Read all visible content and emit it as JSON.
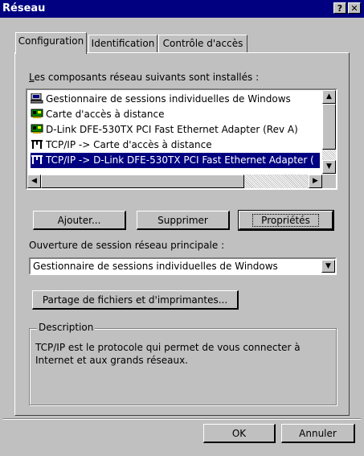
{
  "window": {
    "title": "Réseau",
    "help_button": "?",
    "close_button": "✕"
  },
  "tabs": [
    {
      "label": "Configuration",
      "active": true
    },
    {
      "label": "Identification",
      "active": false
    },
    {
      "label": "Contrôle d'accès",
      "active": false
    }
  ],
  "components": {
    "label": "Les composants réseau suivants sont installés :",
    "items": [
      {
        "label": "Gestionnaire de sessions individuelles de Windows",
        "icon": "client-icon",
        "selected": false
      },
      {
        "label": "Carte d'accès à distance",
        "icon": "network-card-icon",
        "selected": false
      },
      {
        "label": "D-Link DFE-530TX PCI Fast Ethernet Adapter (Rev A)",
        "icon": "network-card-icon",
        "selected": false
      },
      {
        "label": "TCP/IP -> Carte d'accès à distance",
        "icon": "protocol-icon",
        "selected": false
      },
      {
        "label": "TCP/IP -> D-Link DFE-530TX PCI Fast Ethernet Adapter (",
        "icon": "protocol-icon",
        "selected": true
      }
    ]
  },
  "buttons": {
    "add": "Ajouter...",
    "remove": "Supprimer",
    "properties": "Propriétés",
    "sharing": "Partage de fichiers et d'imprimantes...",
    "ok": "OK",
    "cancel": "Annuler"
  },
  "logon": {
    "label": "Ouverture de session réseau principale :",
    "value": "Gestionnaire de sessions individuelles de Windows"
  },
  "description": {
    "title": "Description",
    "text": "TCP/IP est le protocole qui permet de vous connecter à Internet et aux grands réseaux."
  },
  "colors": {
    "title_bar": "#000080",
    "selection": "#000080",
    "face": "#c0c0c0"
  }
}
